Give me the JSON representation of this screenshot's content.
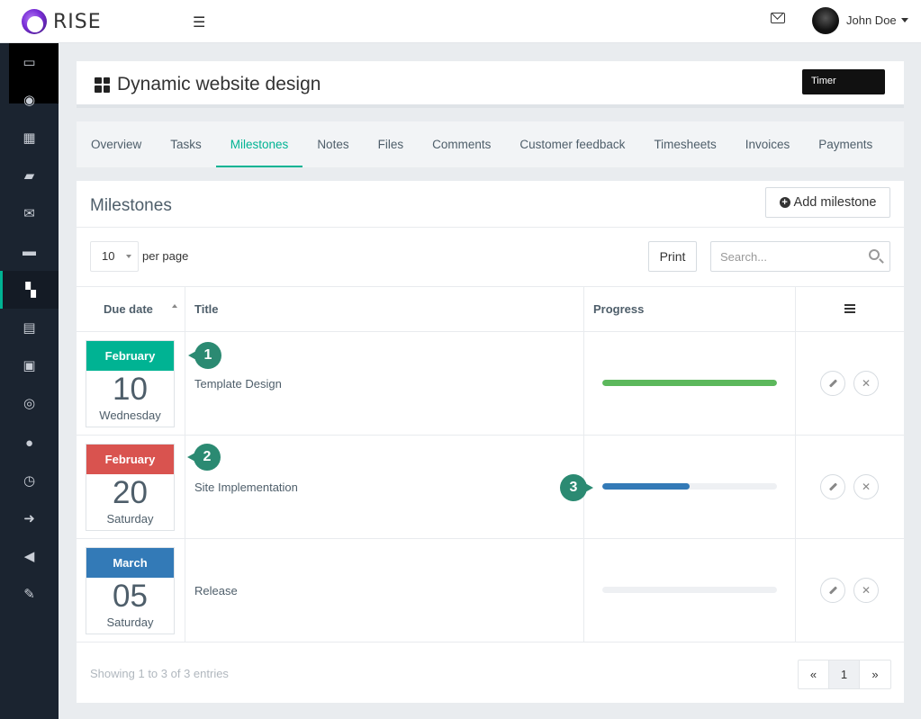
{
  "app": {
    "brand": "RISE"
  },
  "header": {
    "user_name": "John Doe"
  },
  "project": {
    "title": "Dynamic website design",
    "action_label": "Timer"
  },
  "tabs": [
    {
      "label": "Overview"
    },
    {
      "label": "Tasks"
    },
    {
      "label": "Milestones",
      "active": true
    },
    {
      "label": "Notes"
    },
    {
      "label": "Files"
    },
    {
      "label": "Comments"
    },
    {
      "label": "Customer feedback"
    },
    {
      "label": "Timesheets"
    },
    {
      "label": "Invoices"
    },
    {
      "label": "Payments"
    }
  ],
  "panel": {
    "title": "Milestones",
    "add_label": "Add milestone",
    "per_page_value": "10",
    "per_page_label": "per page",
    "print_label": "Print",
    "search_placeholder": "Search..."
  },
  "table": {
    "columns": [
      "Due date",
      "Title",
      "Progress"
    ],
    "rows": [
      {
        "month": "February",
        "day": "10",
        "weekday": "Wednesday",
        "title": "Template Design",
        "progress": 1.0,
        "month_color": "#00b393",
        "bar_color": "#5cb85c"
      },
      {
        "month": "February",
        "day": "20",
        "weekday": "Saturday",
        "title": "Site Implementation",
        "progress": 0.5,
        "month_color": "#d9534f",
        "bar_color": "#337ab7"
      },
      {
        "month": "March",
        "day": "05",
        "weekday": "Saturday",
        "title": "Release",
        "progress": 0.0,
        "month_color": "#337ab7",
        "bar_color": "#337ab7"
      }
    ]
  },
  "callouts": [
    "1",
    "2",
    "3"
  ],
  "footer": {
    "showing": "Showing 1 to 3 of 3 entries",
    "prev": "«",
    "page": "1",
    "next": "»"
  },
  "colors": {
    "accent": "#00b393",
    "sidebar": "#1b2430"
  }
}
